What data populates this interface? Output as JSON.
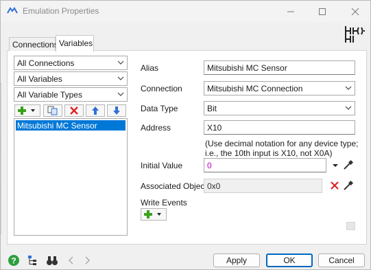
{
  "window": {
    "title": "Emulation Properties"
  },
  "tabs": [
    {
      "label": "Connections",
      "selected": false
    },
    {
      "label": "Variables",
      "selected": true
    }
  ],
  "filters": {
    "connection": "All Connections",
    "variables": "All Variables",
    "variable_types": "All Variable Types"
  },
  "variables_list": {
    "items": [
      "Mitsubishi MC Sensor"
    ],
    "selected_index": 0
  },
  "form": {
    "alias_label": "Alias",
    "alias_value": "Mitsubishi MC Sensor",
    "connection_label": "Connection",
    "connection_value": "Mitsubishi MC Connection",
    "data_type_label": "Data Type",
    "data_type_value": "Bit",
    "address_label": "Address",
    "address_value": "X10",
    "address_hint": "(Use decimal notation for any device type; i.e., the 10th input is X10, not X0A)",
    "initial_value_label": "Initial Value",
    "initial_value": "0",
    "associated_object_label": "Associated Object",
    "associated_object_value": "0x0",
    "write_events_label": "Write Events"
  },
  "buttons": {
    "apply": "Apply",
    "ok": "OK",
    "cancel": "Cancel"
  },
  "colors": {
    "selection": "#0078d7",
    "add_icon": "#3aa11a",
    "delete_icon": "#e02424",
    "arrow_icon": "#2f6fd6",
    "initial_value_text": "#c000c0",
    "ok_border": "#0067c0"
  },
  "icons": [
    "app-icon",
    "plc-ladder-icon",
    "add-icon",
    "copy-icon",
    "delete-icon",
    "move-up-icon",
    "move-down-icon",
    "dropdown-arrow-icon",
    "eyedropper-icon",
    "clear-icon",
    "help-icon",
    "tree-icon",
    "binoculars-icon",
    "back-icon",
    "forward-icon"
  ]
}
